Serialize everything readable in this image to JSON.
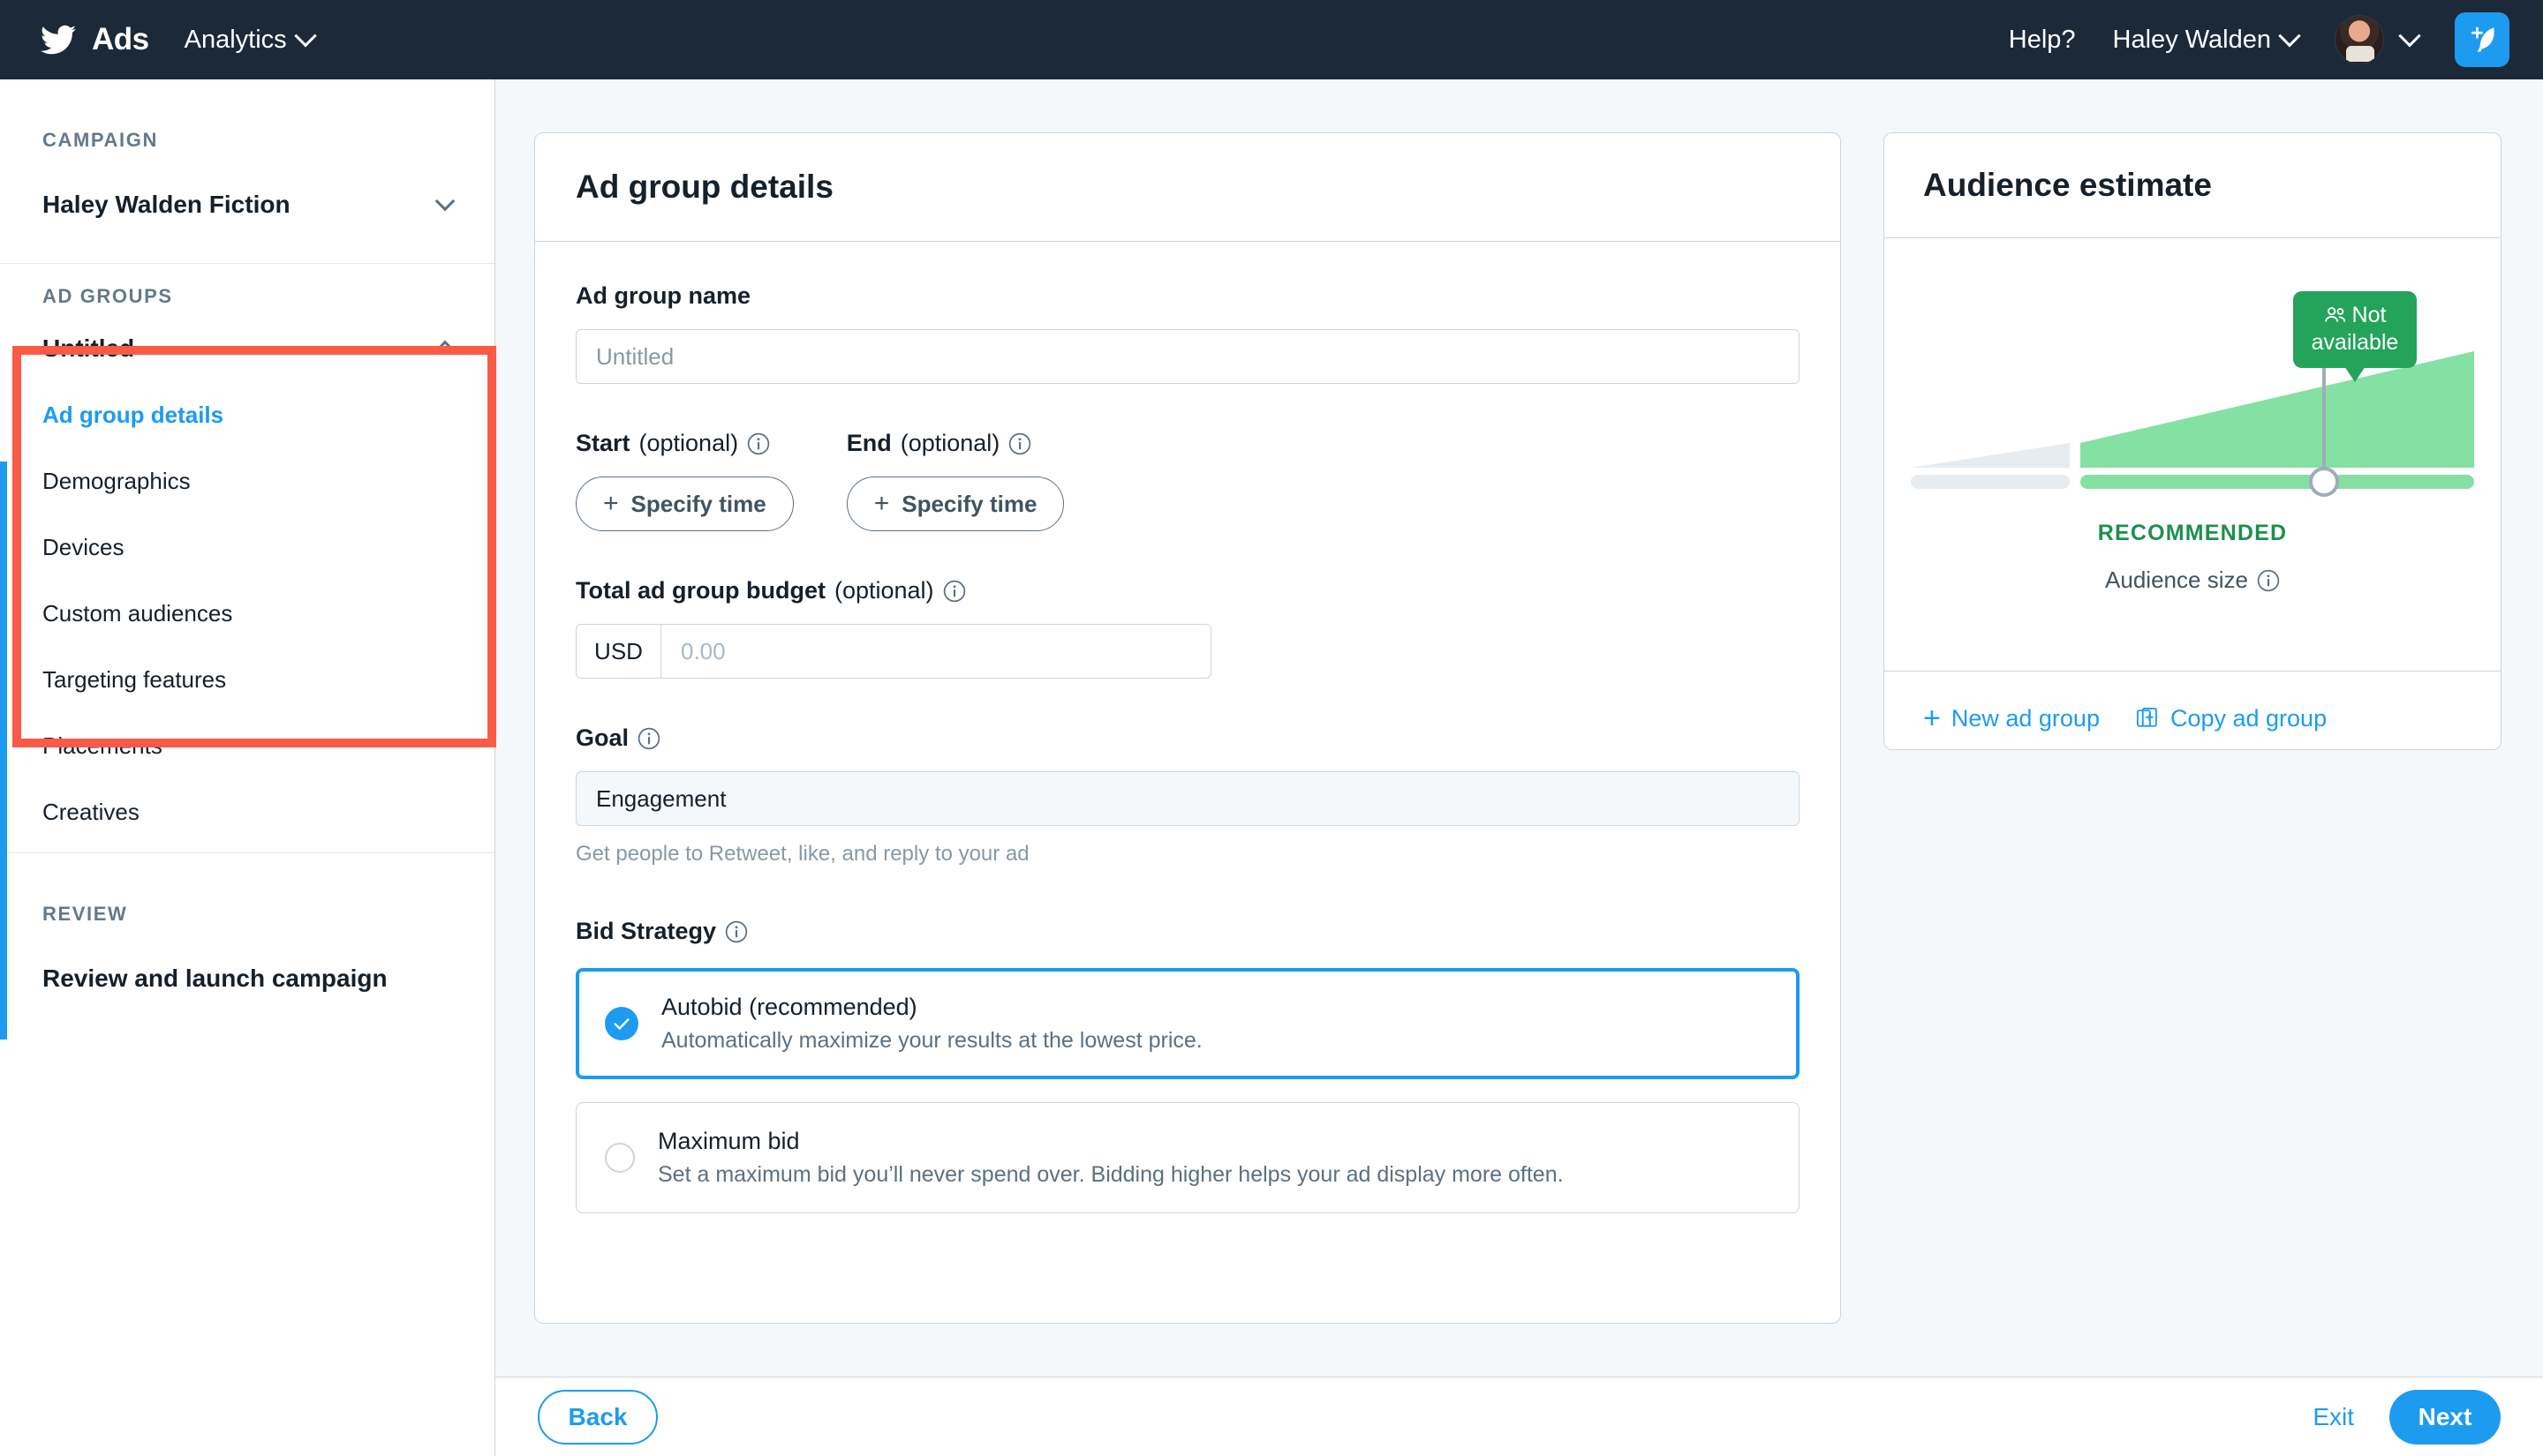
{
  "topnav": {
    "brand": "Ads",
    "logo_icon": "twitter-bird-icon",
    "analytics": "Analytics",
    "help": "Help?",
    "account": "Haley Walden",
    "compose_icon": "compose-tweet-icon",
    "avatar_icon": "user-avatar",
    "accent": "#1d9bf0",
    "bar_color": "#1c2938"
  },
  "sidebar": {
    "campaign_label": "CAMPAIGN",
    "campaign_name": "Haley Walden Fiction",
    "adgroups_label": "AD GROUPS",
    "adgroup_name": "Untitled",
    "items": [
      {
        "label": "Ad group details",
        "active": true
      },
      {
        "label": "Demographics",
        "active": false
      },
      {
        "label": "Devices",
        "active": false
      },
      {
        "label": "Custom audiences",
        "active": false
      },
      {
        "label": "Targeting features",
        "active": false
      },
      {
        "label": "Placements",
        "active": false
      },
      {
        "label": "Creatives",
        "active": false
      }
    ],
    "review_label": "REVIEW",
    "review_item": "Review and launch campaign",
    "highlight_color": "#fa5a46",
    "active_color": "#1d9bf0"
  },
  "form": {
    "title": "Ad group details",
    "name_label": "Ad group name",
    "name_value": "",
    "name_placeholder": "Untitled",
    "start_label": "Start",
    "start_optional": "(optional)",
    "start_button": "Specify time",
    "end_label": "End",
    "end_optional": "(optional)",
    "end_button": "Specify time",
    "budget_label": "Total ad group budget",
    "budget_optional": "(optional)",
    "budget_currency": "USD",
    "budget_value": "",
    "budget_placeholder": "0.00",
    "goal_label": "Goal",
    "goal_value": "Engagement",
    "goal_help": "Get people to Retweet, like, and reply to your ad",
    "bid_label": "Bid Strategy",
    "bid_options": [
      {
        "title": "Autobid (recommended)",
        "desc": "Automatically maximize your results at the lowest price.",
        "selected": true
      },
      {
        "title": "Maximum bid",
        "desc": "Set a maximum bid you’ll never spend over. Bidding higher helps your ad display more often.",
        "selected": false
      }
    ]
  },
  "audience": {
    "title": "Audience estimate",
    "bubble_text": "Not available",
    "bubble_icon": "people-icon",
    "status": "RECOMMENDED",
    "size_label": "Audience size",
    "new_group_link": "New ad group",
    "copy_group_link": "Copy ad group",
    "green": "#24a35a",
    "green_fill": "#85e0a3"
  },
  "footer": {
    "back": "Back",
    "exit": "Exit",
    "next": "Next"
  }
}
